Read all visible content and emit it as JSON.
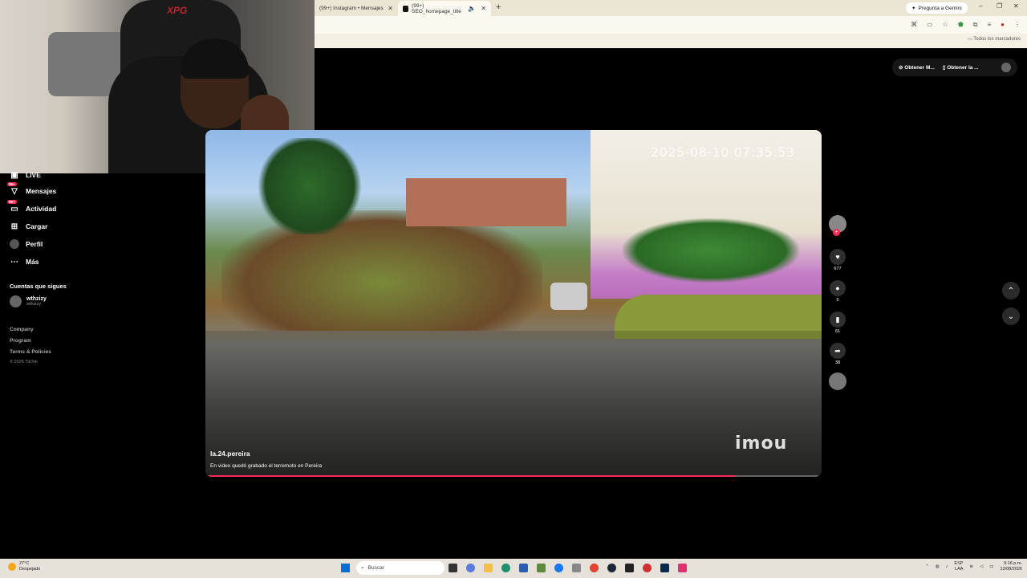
{
  "browser": {
    "tabs": [
      {
        "label": "(99+) Instagram • Mensajes",
        "active": false
      },
      {
        "label": "(99+) SEO_homepage_title",
        "active": true
      }
    ],
    "gemini_label": "Pregunta a Gemini",
    "bookmarks_label": "Todos los marcadores"
  },
  "topbar": {
    "button1": "Obtener M...",
    "button2": "Obtener la ..."
  },
  "sidebar": {
    "items": [
      {
        "label": "LIVE",
        "icon": "live-icon",
        "badge": ""
      },
      {
        "label": "Mensajes",
        "icon": "messages-icon",
        "badge": "99+"
      },
      {
        "label": "Actividad",
        "icon": "activity-icon",
        "badge": "99+"
      },
      {
        "label": "Cargar",
        "icon": "upload-icon",
        "badge": ""
      },
      {
        "label": "Perfil",
        "icon": "profile-icon",
        "badge": ""
      },
      {
        "label": "Más",
        "icon": "more-icon",
        "badge": ""
      }
    ],
    "following_title": "Cuentas que sigues",
    "following": {
      "name": "wthzizy",
      "handle": "wthzizy"
    },
    "footer": [
      "Company",
      "Program",
      "Terms & Policies"
    ],
    "copyright": "© 2026 TikTok"
  },
  "webcam": {
    "chair_logo": "XPG"
  },
  "video": {
    "timestamp": "2025-08-10 07:35:53",
    "watermark": "imou",
    "author": "la.24.pereira",
    "caption": "En video quedó grabado el terremoto en Pereira",
    "progress": 0.86
  },
  "actions": {
    "likes": "677",
    "comments": "5",
    "saves": "61",
    "shares": "38"
  },
  "taskbar": {
    "temperature": "27°C",
    "condition": "Despejado",
    "search_placeholder": "Buscar",
    "lang": "ESP",
    "lang2": "LAA",
    "time": "9:16 p.m.",
    "date": "13/08/2026"
  },
  "colors": {
    "accent": "#fe2c55",
    "background": "#000000",
    "chrome": "#f4f1e4"
  }
}
